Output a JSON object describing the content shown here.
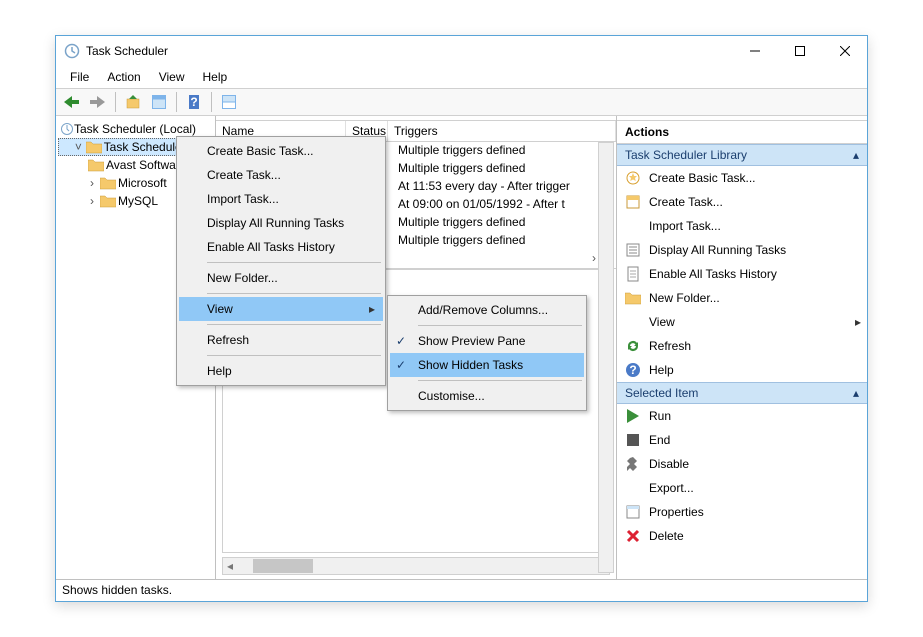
{
  "window": {
    "title": "Task Scheduler"
  },
  "menubar": [
    "File",
    "Action",
    "View",
    "Help"
  ],
  "tree": {
    "root": "Task Scheduler (Local)",
    "library": "Task Scheduler Library",
    "children": [
      "Avast Software",
      "Microsoft",
      "MySQL"
    ]
  },
  "list": {
    "cols": {
      "name": "Name",
      "status": "Status",
      "triggers": "Triggers"
    },
    "triggers": [
      "Multiple triggers defined",
      "Multiple triggers defined",
      "At 11:53 every day - After trigger",
      "At 09:00 on 01/05/1992 - After t",
      "Multiple triggers defined",
      "Multiple triggers defined"
    ]
  },
  "ctx": {
    "create_basic": "Create Basic Task...",
    "create_task": "Create Task...",
    "import_task": "Import Task...",
    "display_running": "Display All Running Tasks",
    "enable_history": "Enable All Tasks History",
    "new_folder": "New Folder...",
    "view": "View",
    "refresh": "Refresh",
    "help": "Help"
  },
  "viewsub": {
    "addremove": "Add/Remove Columns...",
    "preview": "Show Preview Pane",
    "hidden": "Show Hidden Tasks",
    "customise": "Customise..."
  },
  "actions": {
    "title": "Actions",
    "header1": "Task Scheduler Library",
    "items1": [
      {
        "icon": "star",
        "label": "Create Basic Task..."
      },
      {
        "icon": "task",
        "label": "Create Task..."
      },
      {
        "icon": "none",
        "label": "Import Task..."
      },
      {
        "icon": "list",
        "label": "Display All Running Tasks"
      },
      {
        "icon": "doc",
        "label": "Enable All Tasks History"
      },
      {
        "icon": "folder",
        "label": "New Folder..."
      },
      {
        "icon": "none",
        "label": "View",
        "arrow": true
      },
      {
        "icon": "refresh",
        "label": "Refresh"
      },
      {
        "icon": "help",
        "label": "Help"
      }
    ],
    "header2": "Selected Item",
    "items2": [
      {
        "icon": "play",
        "label": "Run"
      },
      {
        "icon": "stop",
        "label": "End"
      },
      {
        "icon": "disable",
        "label": "Disable"
      },
      {
        "icon": "none",
        "label": "Export..."
      },
      {
        "icon": "props",
        "label": "Properties"
      },
      {
        "icon": "delete",
        "label": "Delete"
      }
    ]
  },
  "statusbar": "Shows hidden tasks."
}
